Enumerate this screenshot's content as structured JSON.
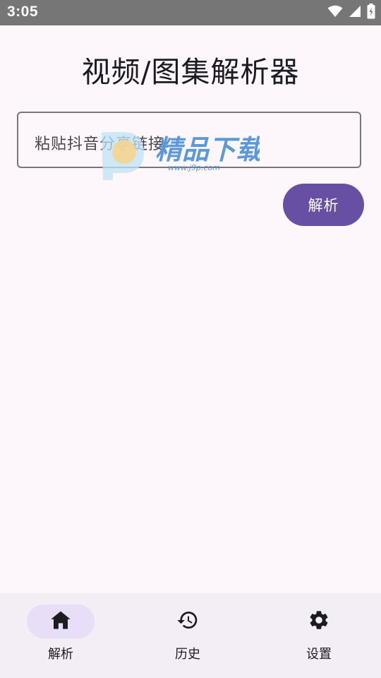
{
  "status_bar": {
    "time": "3:05"
  },
  "title": "视频/图集解析器",
  "input": {
    "placeholder": "粘贴抖音分享链接"
  },
  "parse_button": {
    "label": "解析"
  },
  "watermark": {
    "text": "精品下载",
    "url": "www.j9p.com"
  },
  "bottom_nav": {
    "items": [
      {
        "label": "解析",
        "icon": "home-icon",
        "active": true
      },
      {
        "label": "历史",
        "icon": "history-icon",
        "active": false
      },
      {
        "label": "设置",
        "icon": "settings-icon",
        "active": false
      }
    ]
  },
  "colors": {
    "accent": "#6750a4",
    "active_pill": "#e8def8",
    "background": "#fdf7fc",
    "nav_background": "#f3edf6",
    "status_bar": "#767676"
  }
}
